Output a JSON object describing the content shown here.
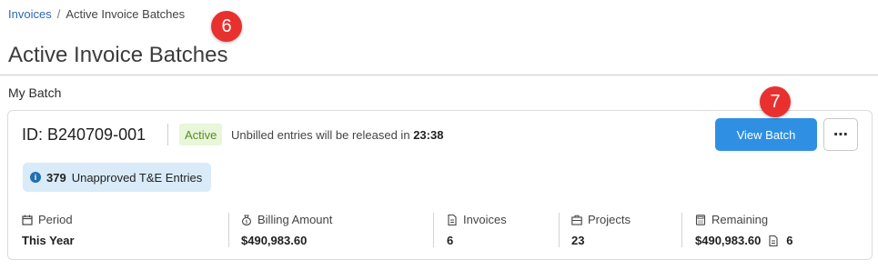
{
  "breadcrumb": {
    "parent": "Invoices",
    "separator": "/",
    "current": "Active Invoice Batches"
  },
  "callouts": {
    "first": "6",
    "second": "7"
  },
  "page_title": "Active Invoice Batches",
  "section_label": "My Batch",
  "batch": {
    "id_text": "ID: B240709-001",
    "status": "Active",
    "release_prefix": "Unbilled entries will be released in",
    "release_time": "23:38",
    "view_button": "View Batch",
    "more_button": "⋯",
    "unapproved_count": "379",
    "unapproved_label": "Unapproved T&E Entries"
  },
  "stats": {
    "period": {
      "label": "Period",
      "value": "This Year",
      "icon": "calendar-icon"
    },
    "billing": {
      "label": "Billing Amount",
      "value": "$490,983.60",
      "icon": "money-bag-icon"
    },
    "invoices": {
      "label": "Invoices",
      "value": "6",
      "icon": "invoice-icon"
    },
    "projects": {
      "label": "Projects",
      "value": "23",
      "icon": "briefcase-icon"
    },
    "remaining": {
      "label": "Remaining",
      "value": "$490,983.60",
      "invoice_count": "6",
      "icon": "calculator-icon"
    }
  },
  "colors": {
    "primary": "#2f90e3",
    "callout": "#e8312f",
    "badge_bg": "#e8f6d9",
    "badge_text": "#5b8a23",
    "info_bg": "#d9ebf8"
  }
}
